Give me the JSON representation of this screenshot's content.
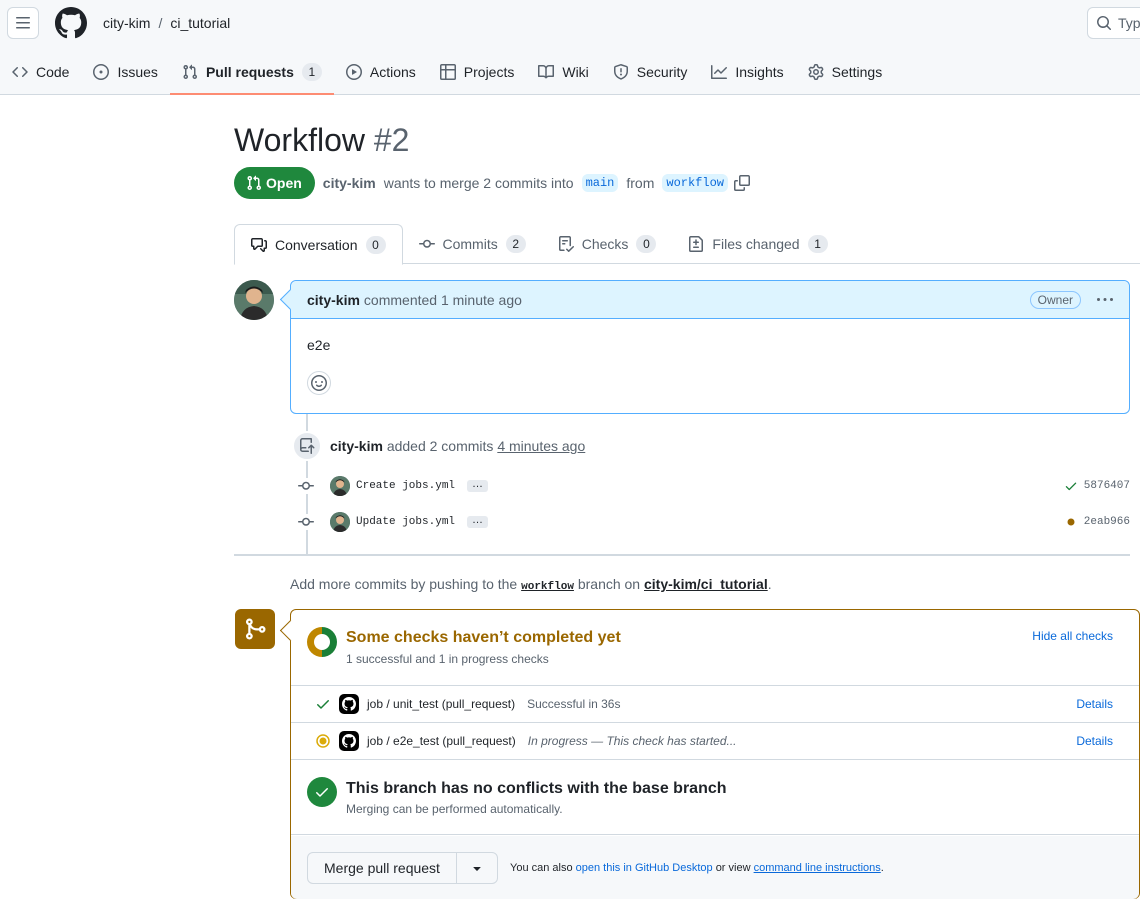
{
  "header": {
    "owner": "city-kim",
    "separator": "/",
    "repo": "ci_tutorial",
    "search_placeholder": "Typ"
  },
  "nav": [
    {
      "label": "Code",
      "icon": "code-icon"
    },
    {
      "label": "Issues",
      "icon": "issue-icon"
    },
    {
      "label": "Pull requests",
      "icon": "pull-request-icon",
      "count": "1",
      "active": true
    },
    {
      "label": "Actions",
      "icon": "play-icon"
    },
    {
      "label": "Projects",
      "icon": "table-icon"
    },
    {
      "label": "Wiki",
      "icon": "book-icon"
    },
    {
      "label": "Security",
      "icon": "shield-icon"
    },
    {
      "label": "Insights",
      "icon": "graph-icon"
    },
    {
      "label": "Settings",
      "icon": "gear-icon"
    }
  ],
  "pr": {
    "title": "Workflow",
    "number": "#2",
    "state": "Open",
    "author": "city-kim",
    "merge_text": "wants to merge 2 commits into",
    "base": "main",
    "from_text": "from",
    "head": "workflow"
  },
  "tabs": [
    {
      "label": "Conversation",
      "count": "0"
    },
    {
      "label": "Commits",
      "count": "2"
    },
    {
      "label": "Checks",
      "count": "0"
    },
    {
      "label": "Files changed",
      "count": "1"
    }
  ],
  "comment": {
    "author": "city-kim",
    "time": "commented 1 minute ago",
    "badge": "Owner",
    "body": "e2e"
  },
  "timeline": {
    "author": "city-kim",
    "action": "added 2 commits",
    "time": "4 minutes ago",
    "commits": [
      {
        "message": "Create jobs.yml",
        "sha": "5876407",
        "status": "success",
        "status_color": "#1a7f37"
      },
      {
        "message": "Update jobs.yml",
        "sha": "2eab966",
        "status": "pending",
        "status_color": "#9a6700"
      }
    ]
  },
  "hint": {
    "prefix": "Add more commits by pushing to the",
    "branch": "workflow",
    "middle": "branch on",
    "repo": "city-kim/ci_tutorial",
    "suffix": "."
  },
  "checks": {
    "title": "Some checks haven’t completed yet",
    "subtitle": "1 successful and 1 in progress checks",
    "hide_label": "Hide all checks",
    "rows": [
      {
        "name": "job / unit_test (pull_request)",
        "status": "Successful in 36s",
        "details": "Details"
      },
      {
        "name": "job / e2e_test (pull_request)",
        "status": "In progress — This check has started...",
        "details": "Details"
      }
    ]
  },
  "conflicts": {
    "title": "This branch has no conflicts with the base branch",
    "subtitle": "Merging can be performed automatically."
  },
  "merge": {
    "button": "Merge pull request",
    "alt_prefix": "You can also",
    "desktop_link": "open this in GitHub Desktop",
    "alt_mid": "or view",
    "cli_link": "command line instructions",
    "alt_suffix": "."
  },
  "colors": {
    "accent": "#0969da",
    "open_green": "#1f883d",
    "pending": "#9a6700",
    "nav_underline": "#fd8c73"
  }
}
